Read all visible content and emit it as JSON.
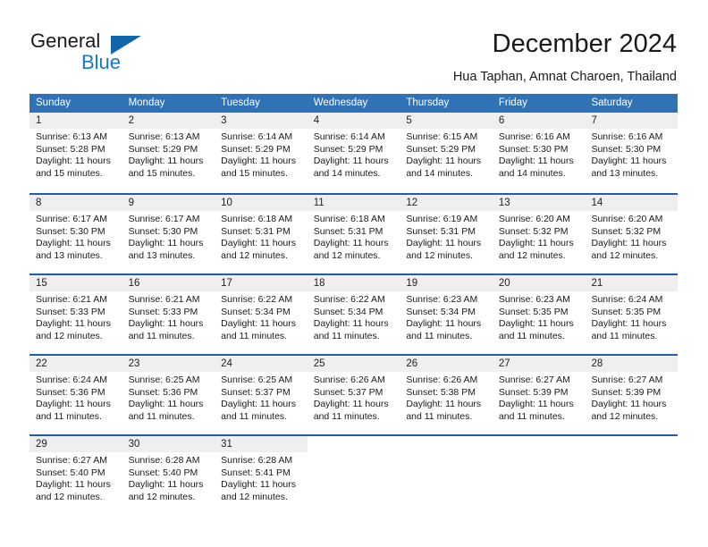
{
  "brand": {
    "name_top": "General",
    "name_bottom": "Blue",
    "logo_icon": "triangle-logo",
    "accent_color": "#1265ab",
    "blue_text_color": "#1579c4"
  },
  "header": {
    "title": "December 2024",
    "subtitle": "Hua Taphan, Amnat Charoen, Thailand"
  },
  "calendar": {
    "header_bg_color": "#2f72b5",
    "row_border_color": "#1f5fa8",
    "daynum_bg_color": "#efefef",
    "weekday_names": [
      "Sunday",
      "Monday",
      "Tuesday",
      "Wednesday",
      "Thursday",
      "Friday",
      "Saturday"
    ],
    "weeks": [
      [
        {
          "day": "1",
          "sunrise": "Sunrise: 6:13 AM",
          "sunset": "Sunset: 5:28 PM",
          "daylight_line1": "Daylight: 11 hours",
          "daylight_line2": "and 15 minutes."
        },
        {
          "day": "2",
          "sunrise": "Sunrise: 6:13 AM",
          "sunset": "Sunset: 5:29 PM",
          "daylight_line1": "Daylight: 11 hours",
          "daylight_line2": "and 15 minutes."
        },
        {
          "day": "3",
          "sunrise": "Sunrise: 6:14 AM",
          "sunset": "Sunset: 5:29 PM",
          "daylight_line1": "Daylight: 11 hours",
          "daylight_line2": "and 15 minutes."
        },
        {
          "day": "4",
          "sunrise": "Sunrise: 6:14 AM",
          "sunset": "Sunset: 5:29 PM",
          "daylight_line1": "Daylight: 11 hours",
          "daylight_line2": "and 14 minutes."
        },
        {
          "day": "5",
          "sunrise": "Sunrise: 6:15 AM",
          "sunset": "Sunset: 5:29 PM",
          "daylight_line1": "Daylight: 11 hours",
          "daylight_line2": "and 14 minutes."
        },
        {
          "day": "6",
          "sunrise": "Sunrise: 6:16 AM",
          "sunset": "Sunset: 5:30 PM",
          "daylight_line1": "Daylight: 11 hours",
          "daylight_line2": "and 14 minutes."
        },
        {
          "day": "7",
          "sunrise": "Sunrise: 6:16 AM",
          "sunset": "Sunset: 5:30 PM",
          "daylight_line1": "Daylight: 11 hours",
          "daylight_line2": "and 13 minutes."
        }
      ],
      [
        {
          "day": "8",
          "sunrise": "Sunrise: 6:17 AM",
          "sunset": "Sunset: 5:30 PM",
          "daylight_line1": "Daylight: 11 hours",
          "daylight_line2": "and 13 minutes."
        },
        {
          "day": "9",
          "sunrise": "Sunrise: 6:17 AM",
          "sunset": "Sunset: 5:30 PM",
          "daylight_line1": "Daylight: 11 hours",
          "daylight_line2": "and 13 minutes."
        },
        {
          "day": "10",
          "sunrise": "Sunrise: 6:18 AM",
          "sunset": "Sunset: 5:31 PM",
          "daylight_line1": "Daylight: 11 hours",
          "daylight_line2": "and 12 minutes."
        },
        {
          "day": "11",
          "sunrise": "Sunrise: 6:18 AM",
          "sunset": "Sunset: 5:31 PM",
          "daylight_line1": "Daylight: 11 hours",
          "daylight_line2": "and 12 minutes."
        },
        {
          "day": "12",
          "sunrise": "Sunrise: 6:19 AM",
          "sunset": "Sunset: 5:31 PM",
          "daylight_line1": "Daylight: 11 hours",
          "daylight_line2": "and 12 minutes."
        },
        {
          "day": "13",
          "sunrise": "Sunrise: 6:20 AM",
          "sunset": "Sunset: 5:32 PM",
          "daylight_line1": "Daylight: 11 hours",
          "daylight_line2": "and 12 minutes."
        },
        {
          "day": "14",
          "sunrise": "Sunrise: 6:20 AM",
          "sunset": "Sunset: 5:32 PM",
          "daylight_line1": "Daylight: 11 hours",
          "daylight_line2": "and 12 minutes."
        }
      ],
      [
        {
          "day": "15",
          "sunrise": "Sunrise: 6:21 AM",
          "sunset": "Sunset: 5:33 PM",
          "daylight_line1": "Daylight: 11 hours",
          "daylight_line2": "and 12 minutes."
        },
        {
          "day": "16",
          "sunrise": "Sunrise: 6:21 AM",
          "sunset": "Sunset: 5:33 PM",
          "daylight_line1": "Daylight: 11 hours",
          "daylight_line2": "and 11 minutes."
        },
        {
          "day": "17",
          "sunrise": "Sunrise: 6:22 AM",
          "sunset": "Sunset: 5:34 PM",
          "daylight_line1": "Daylight: 11 hours",
          "daylight_line2": "and 11 minutes."
        },
        {
          "day": "18",
          "sunrise": "Sunrise: 6:22 AM",
          "sunset": "Sunset: 5:34 PM",
          "daylight_line1": "Daylight: 11 hours",
          "daylight_line2": "and 11 minutes."
        },
        {
          "day": "19",
          "sunrise": "Sunrise: 6:23 AM",
          "sunset": "Sunset: 5:34 PM",
          "daylight_line1": "Daylight: 11 hours",
          "daylight_line2": "and 11 minutes."
        },
        {
          "day": "20",
          "sunrise": "Sunrise: 6:23 AM",
          "sunset": "Sunset: 5:35 PM",
          "daylight_line1": "Daylight: 11 hours",
          "daylight_line2": "and 11 minutes."
        },
        {
          "day": "21",
          "sunrise": "Sunrise: 6:24 AM",
          "sunset": "Sunset: 5:35 PM",
          "daylight_line1": "Daylight: 11 hours",
          "daylight_line2": "and 11 minutes."
        }
      ],
      [
        {
          "day": "22",
          "sunrise": "Sunrise: 6:24 AM",
          "sunset": "Sunset: 5:36 PM",
          "daylight_line1": "Daylight: 11 hours",
          "daylight_line2": "and 11 minutes."
        },
        {
          "day": "23",
          "sunrise": "Sunrise: 6:25 AM",
          "sunset": "Sunset: 5:36 PM",
          "daylight_line1": "Daylight: 11 hours",
          "daylight_line2": "and 11 minutes."
        },
        {
          "day": "24",
          "sunrise": "Sunrise: 6:25 AM",
          "sunset": "Sunset: 5:37 PM",
          "daylight_line1": "Daylight: 11 hours",
          "daylight_line2": "and 11 minutes."
        },
        {
          "day": "25",
          "sunrise": "Sunrise: 6:26 AM",
          "sunset": "Sunset: 5:37 PM",
          "daylight_line1": "Daylight: 11 hours",
          "daylight_line2": "and 11 minutes."
        },
        {
          "day": "26",
          "sunrise": "Sunrise: 6:26 AM",
          "sunset": "Sunset: 5:38 PM",
          "daylight_line1": "Daylight: 11 hours",
          "daylight_line2": "and 11 minutes."
        },
        {
          "day": "27",
          "sunrise": "Sunrise: 6:27 AM",
          "sunset": "Sunset: 5:39 PM",
          "daylight_line1": "Daylight: 11 hours",
          "daylight_line2": "and 11 minutes."
        },
        {
          "day": "28",
          "sunrise": "Sunrise: 6:27 AM",
          "sunset": "Sunset: 5:39 PM",
          "daylight_line1": "Daylight: 11 hours",
          "daylight_line2": "and 12 minutes."
        }
      ],
      [
        {
          "day": "29",
          "sunrise": "Sunrise: 6:27 AM",
          "sunset": "Sunset: 5:40 PM",
          "daylight_line1": "Daylight: 11 hours",
          "daylight_line2": "and 12 minutes."
        },
        {
          "day": "30",
          "sunrise": "Sunrise: 6:28 AM",
          "sunset": "Sunset: 5:40 PM",
          "daylight_line1": "Daylight: 11 hours",
          "daylight_line2": "and 12 minutes."
        },
        {
          "day": "31",
          "sunrise": "Sunrise: 6:28 AM",
          "sunset": "Sunset: 5:41 PM",
          "daylight_line1": "Daylight: 11 hours",
          "daylight_line2": "and 12 minutes."
        },
        {
          "day": "",
          "sunrise": "",
          "sunset": "",
          "daylight_line1": "",
          "daylight_line2": ""
        },
        {
          "day": "",
          "sunrise": "",
          "sunset": "",
          "daylight_line1": "",
          "daylight_line2": ""
        },
        {
          "day": "",
          "sunrise": "",
          "sunset": "",
          "daylight_line1": "",
          "daylight_line2": ""
        },
        {
          "day": "",
          "sunrise": "",
          "sunset": "",
          "daylight_line1": "",
          "daylight_line2": ""
        }
      ]
    ]
  }
}
